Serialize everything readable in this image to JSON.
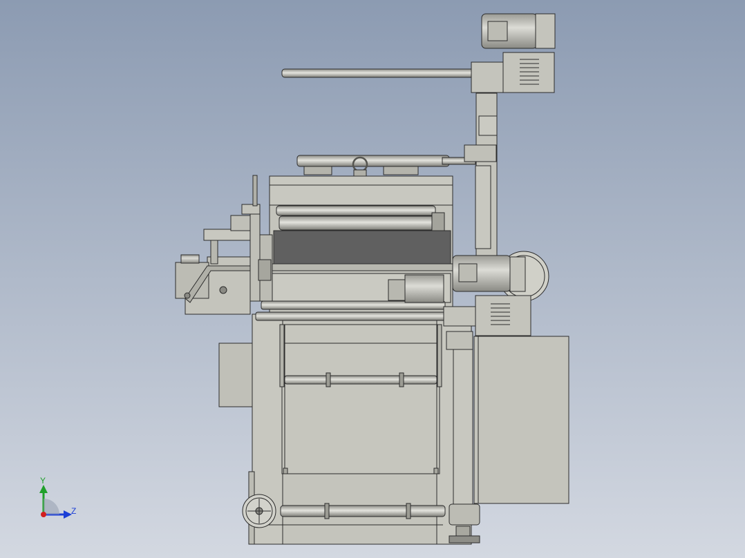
{
  "view": {
    "background_top": "#8c9bb2",
    "background_bottom": "#d3d8e1",
    "part_fill": "#c4c4bc",
    "part_fill_light": "#d2d2cb",
    "part_fill_dark": "#a9a9a1",
    "belt_fill": "#606060",
    "edge_color": "#2b2b2b"
  },
  "triad": {
    "y_label": "Y",
    "z_label": "Z",
    "y_color": "#1fa02a",
    "z_color": "#1c3fd6",
    "origin_color": "#d21f1f"
  }
}
